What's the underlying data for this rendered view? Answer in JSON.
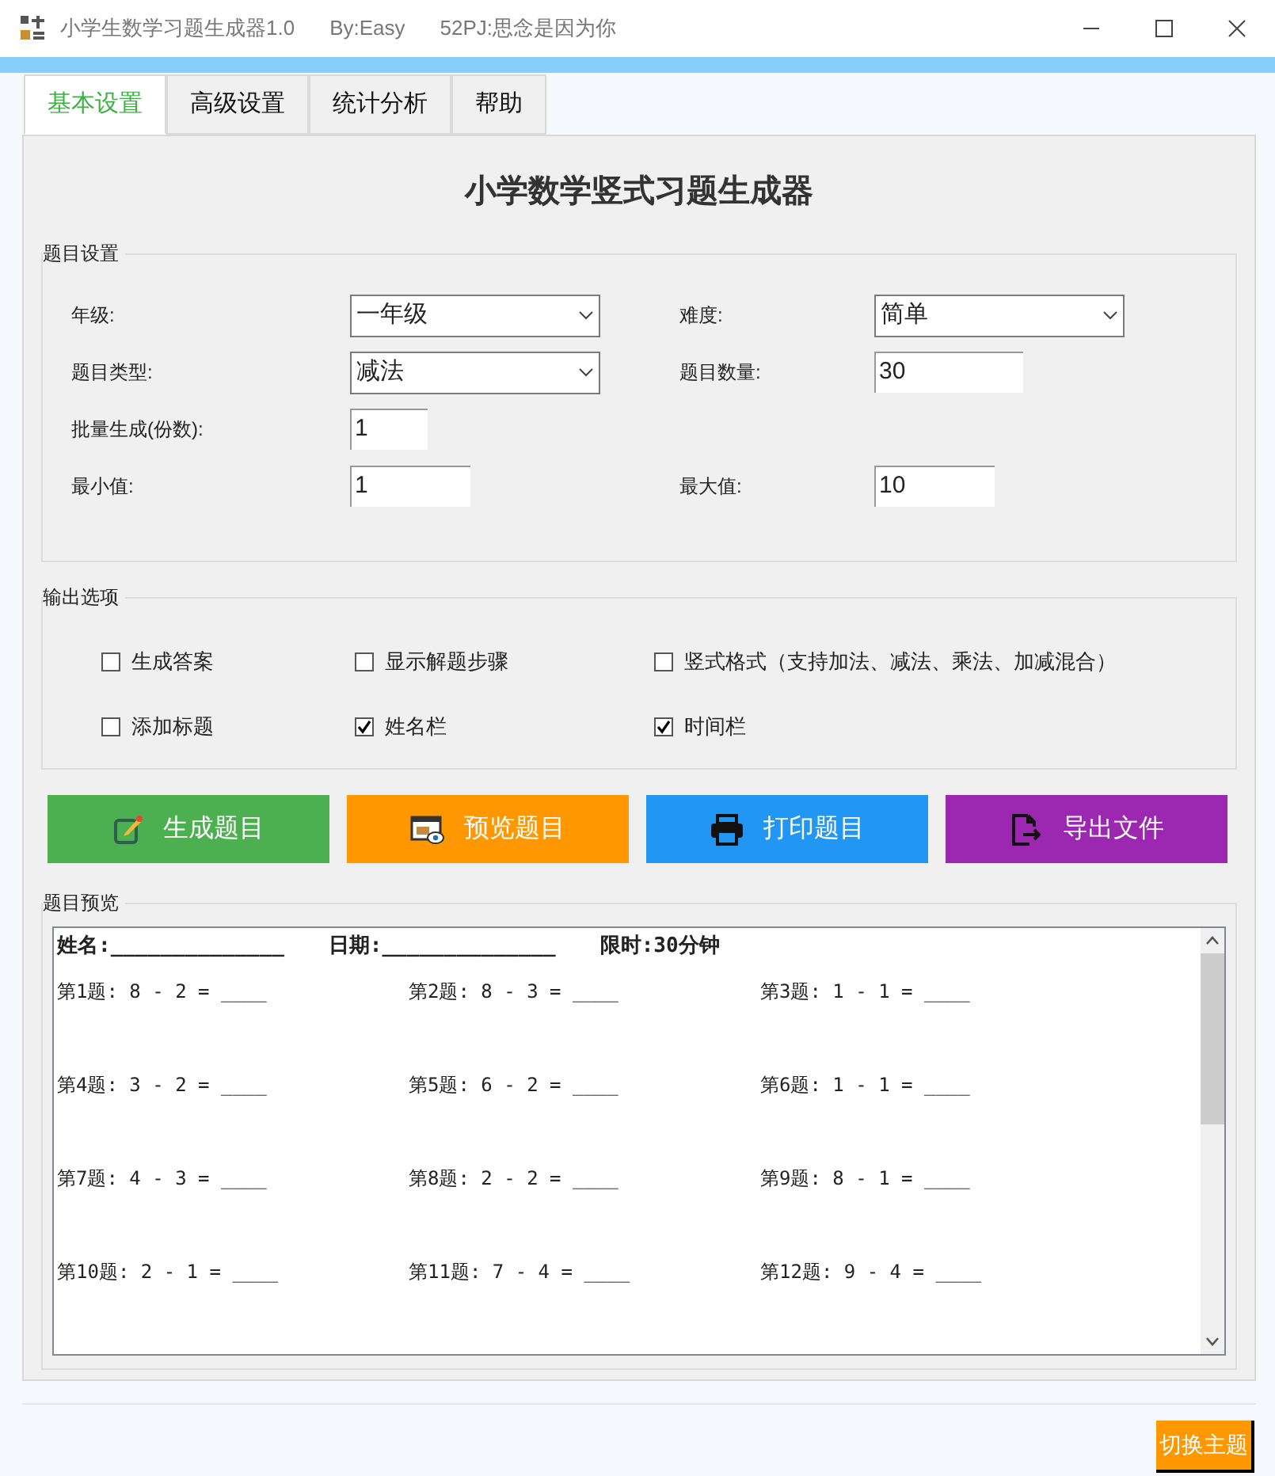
{
  "window": {
    "title": "小学生数学习题生成器1.0",
    "author": "By:Easy",
    "credit": "52PJ:思念是因为你"
  },
  "tabs": [
    {
      "label": "基本设置",
      "selected": true
    },
    {
      "label": "高级设置",
      "selected": false
    },
    {
      "label": "统计分析",
      "selected": false
    },
    {
      "label": "帮助",
      "selected": false
    }
  ],
  "heading": "小学数学竖式习题生成器",
  "settings": {
    "title": "题目设置",
    "rows": [
      [
        {
          "label": "年级:",
          "kind": "dropdown",
          "value": "一年级"
        },
        {
          "label": "难度:",
          "kind": "dropdown",
          "value": "简单"
        }
      ],
      [
        {
          "label": "题目类型:",
          "kind": "dropdown",
          "value": "减法"
        },
        {
          "label": "题目数量:",
          "kind": "number",
          "value": "30"
        }
      ],
      [
        {
          "label": "批量生成(份数):",
          "kind": "small",
          "value": "1"
        }
      ],
      [
        {
          "label": "最小值:",
          "kind": "number",
          "value": "1"
        },
        {
          "label": "最大值:",
          "kind": "number",
          "value": "10"
        }
      ]
    ]
  },
  "output_options": {
    "title": "输出选项",
    "rows": [
      [
        {
          "label": "生成答案",
          "checked": false
        },
        {
          "label": "显示解题步骤",
          "checked": false
        },
        {
          "label": "竖式格式（支持加法、减法、乘法、加减混合）",
          "checked": false
        }
      ],
      [
        {
          "label": "添加标题",
          "checked": false
        },
        {
          "label": "姓名栏",
          "checked": true
        },
        {
          "label": "时间栏",
          "checked": true
        }
      ]
    ]
  },
  "actions": [
    {
      "label": "生成题目",
      "kind": "generate",
      "color": "#4caf50"
    },
    {
      "label": "预览题目",
      "kind": "preview",
      "color": "#ff9800"
    },
    {
      "label": "打印题目",
      "kind": "print",
      "color": "#2196f3"
    },
    {
      "label": "导出文件",
      "kind": "export",
      "color": "#9c27b0"
    }
  ],
  "preview": {
    "title": "题目预览",
    "header": [
      "姓名:______________",
      "日期:______________",
      "限时:30分钟"
    ],
    "problems": [
      "第1题: 8 - 2 = ____",
      "第2题: 8 - 3 = ____",
      "第3题: 1 - 1 = ____",
      "第4题: 3 - 2 = ____",
      "第5题: 6 - 2 = ____",
      "第6题: 1 - 1 = ____",
      "第7题: 4 - 3 = ____",
      "第8题: 2 - 2 = ____",
      "第9题: 8 - 1 = ____",
      "第10题: 2 - 1 = ____",
      "第11题: 7 - 4 = ____",
      "第12题: 9 - 4 = ____"
    ]
  },
  "theme_button": "切换主题"
}
